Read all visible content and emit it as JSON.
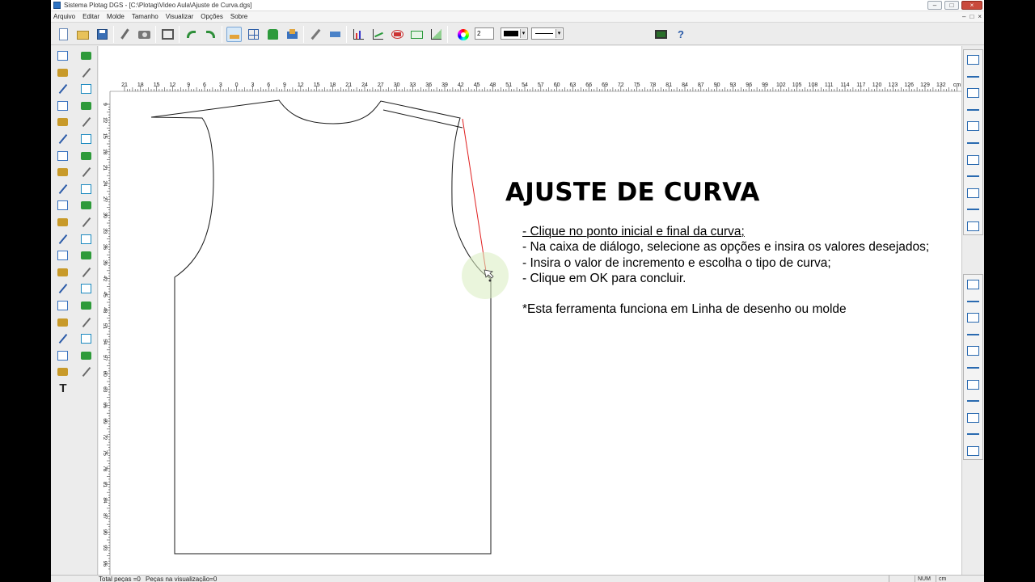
{
  "window": {
    "title": "Sistema Plotag DGS - [C:\\Plotag\\Video Aula\\Ajuste de Curva.dgs]",
    "controls": [
      "–",
      "□",
      "×"
    ]
  },
  "menu": {
    "items": [
      "Arquivo",
      "Editar",
      "Molde",
      "Tamanho",
      "Visualizar",
      "Opções",
      "Sobre"
    ],
    "mdi_controls": [
      "–",
      "□",
      "×"
    ]
  },
  "toolbar": {
    "line_width_value": "2",
    "color_value": "#000000",
    "line_style_value": "———"
  },
  "ruler": {
    "h_labels": [
      "21",
      "18",
      "15",
      "12",
      "9",
      "6",
      "3",
      "0",
      "3",
      "6",
      "9",
      "12",
      "15",
      "18",
      "21",
      "24",
      "27",
      "30",
      "33",
      "36",
      "39",
      "42",
      "45",
      "48",
      "51",
      "54",
      "57",
      "60",
      "63",
      "66",
      "69",
      "72",
      "75",
      "78",
      "81",
      "84",
      "87",
      "90",
      "93",
      "96",
      "99",
      "102",
      "105",
      "108",
      "111",
      "114",
      "117",
      "120",
      "123",
      "126",
      "129",
      "132",
      "cm"
    ],
    "v_labels": [
      "9",
      "12",
      "15",
      "18",
      "21",
      "24",
      "27",
      "30",
      "33",
      "36",
      "39",
      "42",
      "45",
      "48",
      "51",
      "54",
      "57",
      "60",
      "63",
      "66",
      "69",
      "72",
      "75",
      "78",
      "81",
      "84",
      "87",
      "90",
      "93",
      "96"
    ]
  },
  "content": {
    "title": "AJUSTE DE CURVA",
    "instructions": [
      "- Clique no ponto inicial e final da curva;",
      "- Na caixa de diálogo, selecione as opções e insira os valores desejados;",
      "- Insira o valor de incremento e escolha o tipo de curva;",
      "- Clique em OK para concluir."
    ],
    "note": "*Esta ferramenta funciona em Linha de desenho ou molde"
  },
  "status": {
    "total": "Total peças =0",
    "visible": "Peças na visualização=0",
    "num": "NUM",
    "unit": "cm"
  },
  "colors": {
    "accent_red": "#e02020",
    "highlight": "#d8ecc0"
  }
}
